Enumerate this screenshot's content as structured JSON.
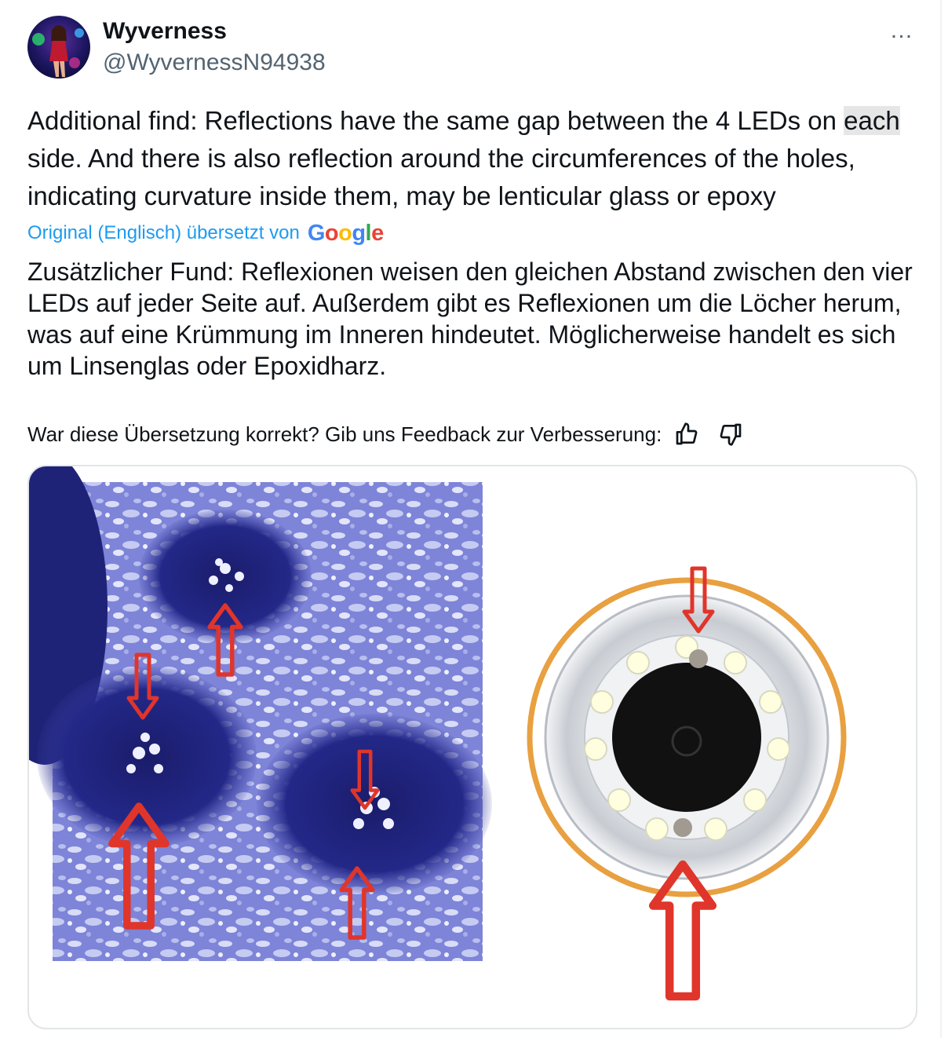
{
  "author": {
    "display_name": "Wyverness",
    "handle": "@WyvernessN94938",
    "more_icon": "…"
  },
  "tweet": {
    "text_before": "Additional find: Reflections have the same gap between the 4 LEDs on ",
    "text_highlight": "each",
    "text_after": " side. And there is also reflection around the circumferences of the holes, indicating curvature inside them, may be lenticular glass or epoxy"
  },
  "translation": {
    "attribution": "Original (Englisch) übersetzt von",
    "provider": "Google",
    "text": "Zusätzlicher Fund: Reflexionen weisen den gleichen Abstand zwischen den vier LEDs auf jeder Seite auf. Außerdem gibt es Reflexionen um die Löcher herum, was auf eine Krümmung im Inneren hindeutet. Möglicherweise handelt es sich um Linsenglas oder Epoxidharz."
  },
  "feedback": {
    "question": "War diese Übersetzung korrekt? Gib uns Feedback zur Verbesserung:",
    "thumbs_up_icon": "thumbs-up-icon",
    "thumbs_down_icon": "thumbs-down-icon"
  },
  "colors": {
    "link_blue": "#1d9bf0",
    "secondary_text": "#536471",
    "arrow_red": "#e0352b",
    "ring_orange": "#e8a040"
  }
}
